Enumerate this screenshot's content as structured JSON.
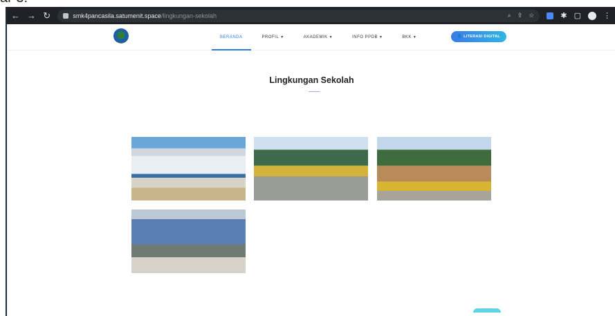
{
  "doc_fragment": "ar 3:",
  "browser": {
    "url_host": "smk4pancasila.satumenit.space",
    "url_path": "/lingkungan-sekolah",
    "icons": [
      "back-icon",
      "forward-icon",
      "reload-icon",
      "lock-icon",
      "zoom-icon",
      "share-icon",
      "star-icon",
      "extension-icon",
      "puzzle-icon",
      "sidepanel-icon",
      "profile-icon",
      "menu-icon"
    ]
  },
  "navbar": {
    "menu": [
      {
        "label": "BERANDA",
        "active": true
      },
      {
        "label": "PROFIL",
        "dropdown": true
      },
      {
        "label": "AKADEMIK",
        "dropdown": true
      },
      {
        "label": "INFO PPDB",
        "dropdown": true
      },
      {
        "label": "BKK",
        "dropdown": true
      }
    ],
    "cta_label": "LITERASI DIGITAL",
    "accent": "#2c7be5"
  },
  "page": {
    "title": "Lingkungan Sekolah"
  },
  "gallery": {
    "images": [
      "school-building-front",
      "school-courtyard-trees",
      "school-walkway-plants",
      "school-stage-banner"
    ]
  }
}
